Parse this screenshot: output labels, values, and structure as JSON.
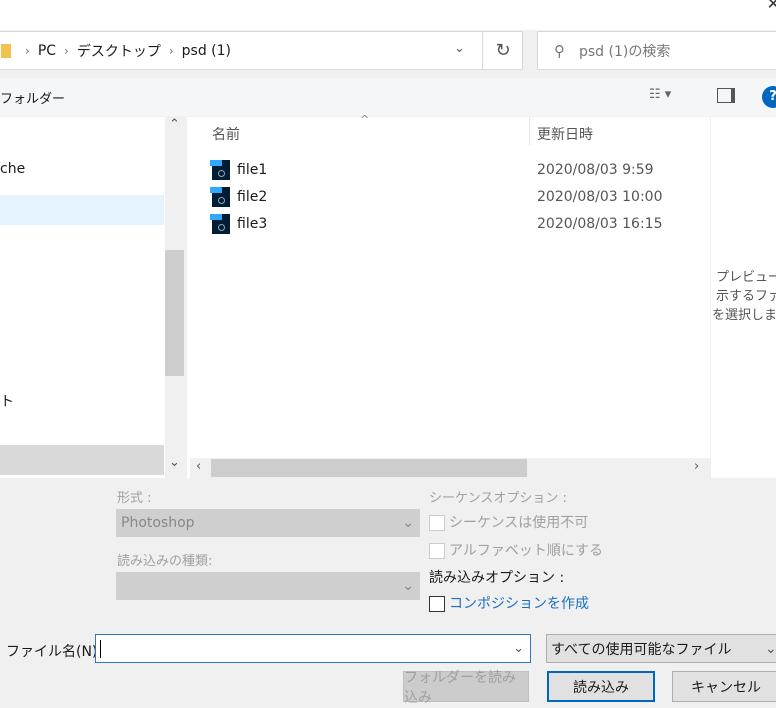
{
  "breadcrumb": [
    "PC",
    "デスクトップ",
    "psd (1)"
  ],
  "search": {
    "placeholder": "psd (1)の検索"
  },
  "toolbar": {
    "new_folder": "フォルダー"
  },
  "nav": {
    "items": [
      "che",
      "ト"
    ]
  },
  "columns": {
    "name": "名前",
    "date": "更新日時"
  },
  "files": [
    {
      "name": "file1",
      "date": "2020/08/03 9:59"
    },
    {
      "name": "file2",
      "date": "2020/08/03 10:00"
    },
    {
      "name": "file3",
      "date": "2020/08/03 16:15"
    }
  ],
  "preview": {
    "lines": [
      "プレビューを",
      "示するファ",
      "を選択しま"
    ]
  },
  "options": {
    "format_label": "形式 :",
    "format_value": "Photoshop",
    "import_type_label": "読み込みの種類:",
    "sequence_label": "シーケンスオプション :",
    "sequence_disabled": "シーケンスは使用不可",
    "alphabetical": "アルファベット順にする",
    "import_options_label": "読み込みオプション :",
    "create_composition": "コンポジションを作成"
  },
  "filename": {
    "label": "ファイル名(N):",
    "value": ""
  },
  "filetype": {
    "value": "すべての使用可能なファイル"
  },
  "buttons": {
    "import_folder": "フォルダーを読み込み",
    "import": "読み込み",
    "cancel": "キャンセル"
  },
  "colors": {
    "accent": "#0067c0",
    "link": "#1a6fc4",
    "selected": "#e5f3ff"
  }
}
